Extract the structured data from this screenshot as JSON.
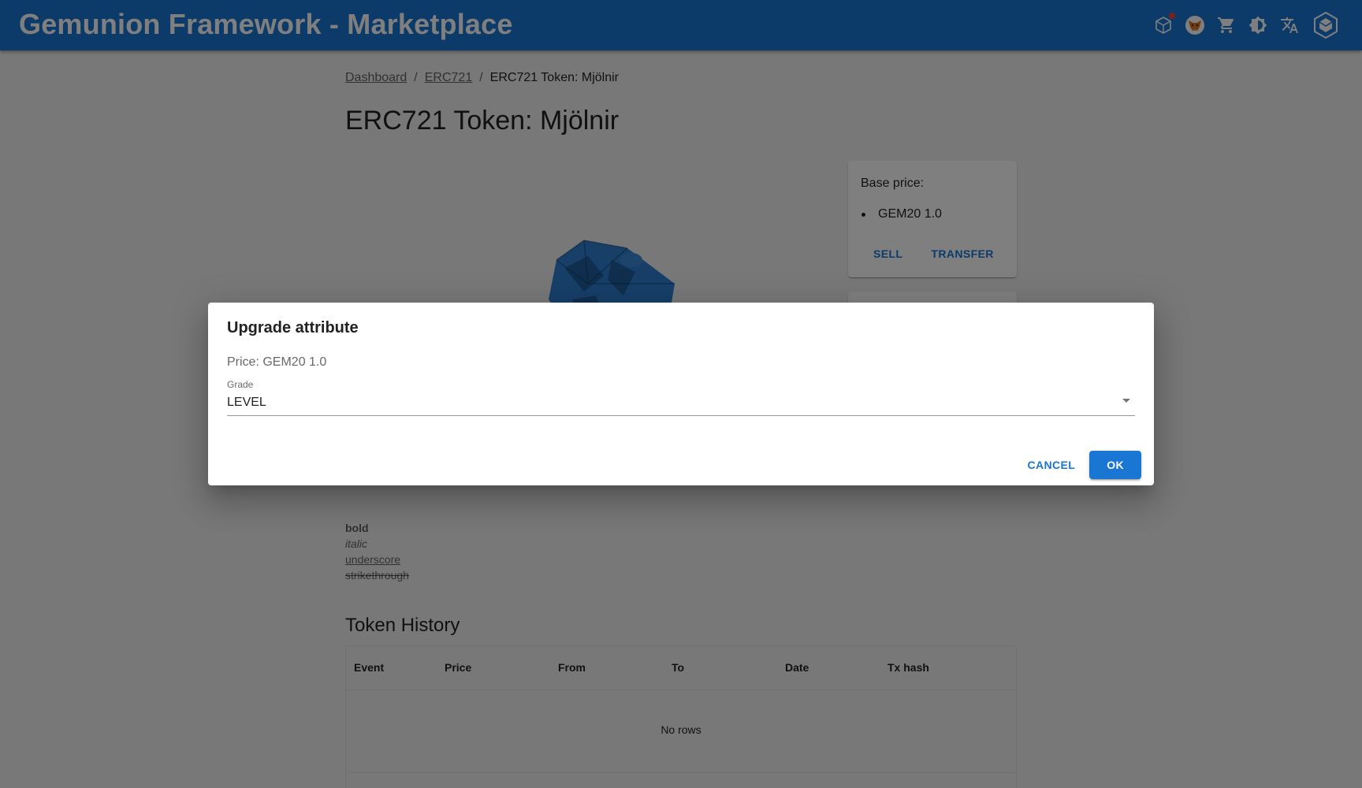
{
  "app": {
    "title": "Gemunion Framework - Marketplace",
    "colors": {
      "primary": "#1976d2",
      "notification": "#f44336"
    },
    "icons": [
      "network-icon",
      "metamask-fox-icon",
      "cart-icon",
      "theme-toggle-icon",
      "translate-icon",
      "logo-icon"
    ]
  },
  "breadcrumb": {
    "items": [
      {
        "label": "Dashboard",
        "link": true
      },
      {
        "label": "ERC721",
        "link": true
      },
      {
        "label": "ERC721 Token: Mjölnir",
        "link": false
      }
    ],
    "separator": "/"
  },
  "page": {
    "title": "ERC721 Token: Mjölnir"
  },
  "price_card": {
    "label": "Base price:",
    "items": [
      "GEM20 1.0"
    ],
    "actions": {
      "sell": "SELL",
      "transfer": "TRANSFER"
    }
  },
  "description": {
    "bold": "bold",
    "italic": "italic",
    "underscore": "underscore",
    "strikethrough": "strikethrough"
  },
  "history": {
    "title": "Token History",
    "columns": [
      "Event",
      "Price",
      "From",
      "To",
      "Date",
      "Tx hash"
    ],
    "empty": "No rows"
  },
  "dialog": {
    "title": "Upgrade attribute",
    "price": "Price: GEM20 1.0",
    "select": {
      "label": "Grade",
      "value": "LEVEL"
    },
    "cancel": "CANCEL",
    "ok": "OK"
  }
}
